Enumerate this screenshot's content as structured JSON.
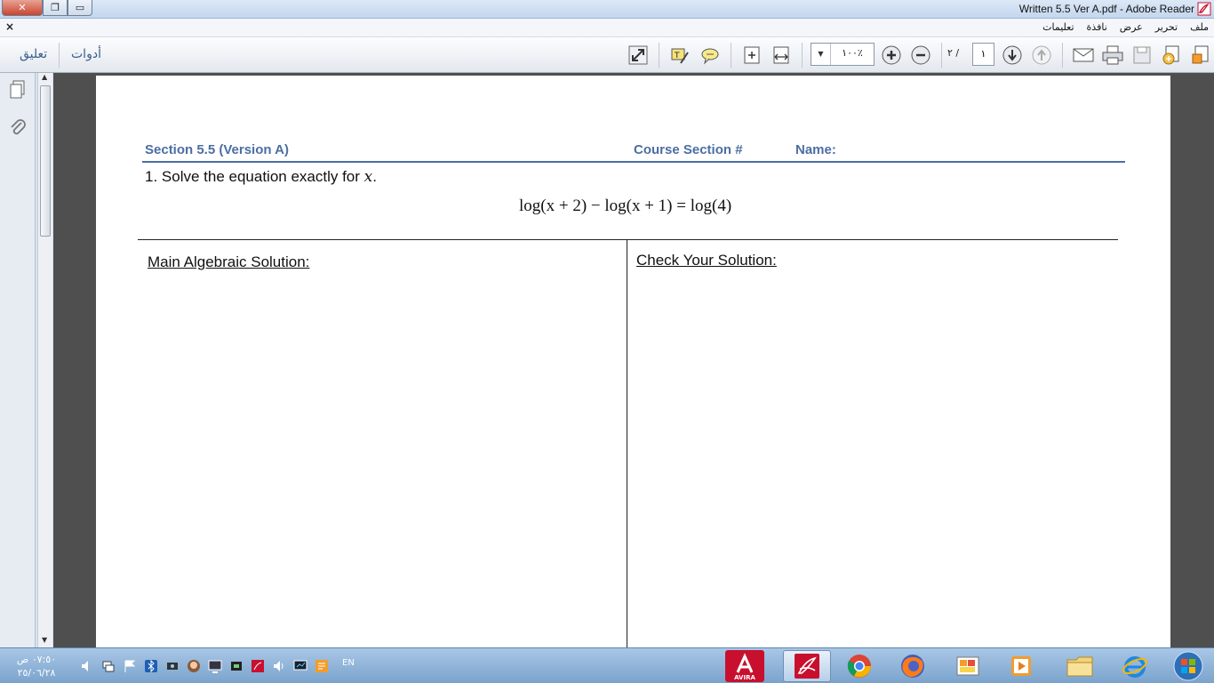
{
  "window": {
    "title": "Written 5.5 Ver A.pdf - Adobe Reader",
    "close_glyph": "✕",
    "maximize_glyph": "❐",
    "minimize_glyph": "▭"
  },
  "menu": {
    "close_glyph": "×",
    "items": [
      "ملف",
      "تحرير",
      "عرض",
      "نافذة",
      "تعليمات"
    ]
  },
  "toolbar": {
    "comment_label": "تعليق",
    "tools_label": "أدوات",
    "zoom_value": "١٠٠٪",
    "current_page": "١",
    "page_total": "٢ /"
  },
  "document": {
    "header_section": "Section 5.5 (Version A)",
    "header_course": "Course  Section #",
    "header_name": "Name:",
    "question_prefix": "1. Solve the equation exactly for ",
    "question_var": "x",
    "question_suffix": ".",
    "equation": "log(x + 2) − log(x + 1) = log(4)",
    "left_heading": "Main Algebraic Solution:",
    "right_heading": "Check Your Solution:"
  },
  "taskbar": {
    "time": "٠٧:٥٠ ص",
    "date": "٢٥/٠٦/٢٨",
    "language": "EN",
    "avira_label": "AVIRA"
  },
  "colors": {
    "header_blue": "#4c6ea3",
    "acrobat_red": "#c8102e",
    "workspace_gray": "#4f4f4f"
  }
}
